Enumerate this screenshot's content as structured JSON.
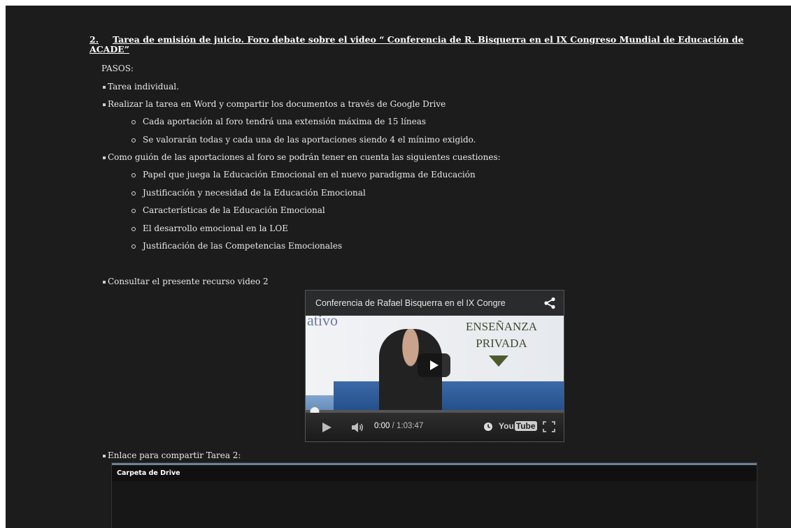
{
  "section": {
    "number": "2.",
    "title": "Tarea de emisión de juicio. Foro debate sobre el video “ Conferencia de R. Bisquerra en el IX Congreso Mundial de Educación de ACADE”"
  },
  "pasos_label": "PASOS:",
  "items": [
    {
      "type": "bullet",
      "text": "Tarea individual."
    },
    {
      "type": "bullet",
      "text": "Realizar la tarea en Word y compartir los documentos a través de Google Drive"
    },
    {
      "type": "sub",
      "text": "Cada aportación al foro tendrá una extensión máxima de 15 líneas"
    },
    {
      "type": "sub",
      "text": "Se valorarán todas y cada una de las aportaciones siendo 4 el mínimo exigido."
    },
    {
      "type": "bullet",
      "text": "Como guión de las aportaciones al foro se podrán tener en cuenta las siguientes cuestiones:"
    },
    {
      "type": "sub",
      "text": "Papel que juega la Educación Emocional en el nuevo paradigma de Educación"
    },
    {
      "type": "sub",
      "text": "Justificación y necesidad de la Educación Emocional"
    },
    {
      "type": "sub",
      "text": "Características de la Educación Emocional"
    },
    {
      "type": "sub",
      "text": "El desarrollo emocional en la LOE"
    },
    {
      "type": "sub",
      "text": "Justificación de las Competencias Emocionales"
    },
    {
      "type": "bullet",
      "text": "Consultar el presente recurso video 2"
    },
    {
      "type": "bullet",
      "text": "Enlace para compartir Tarea 2:"
    }
  ],
  "video": {
    "title": "Conferencia de Rafael Bisquerra en el IX Congre",
    "sign_line1": "ENSEÑANZA",
    "sign_line2": "PRIVADA",
    "left_word": "ativo",
    "current_time": "0:00",
    "duration": "/ 1:03:47",
    "logo_you": "You",
    "logo_tube": "Tube",
    "progress": 0
  },
  "drive": {
    "header": "Carpeta de Drive"
  }
}
